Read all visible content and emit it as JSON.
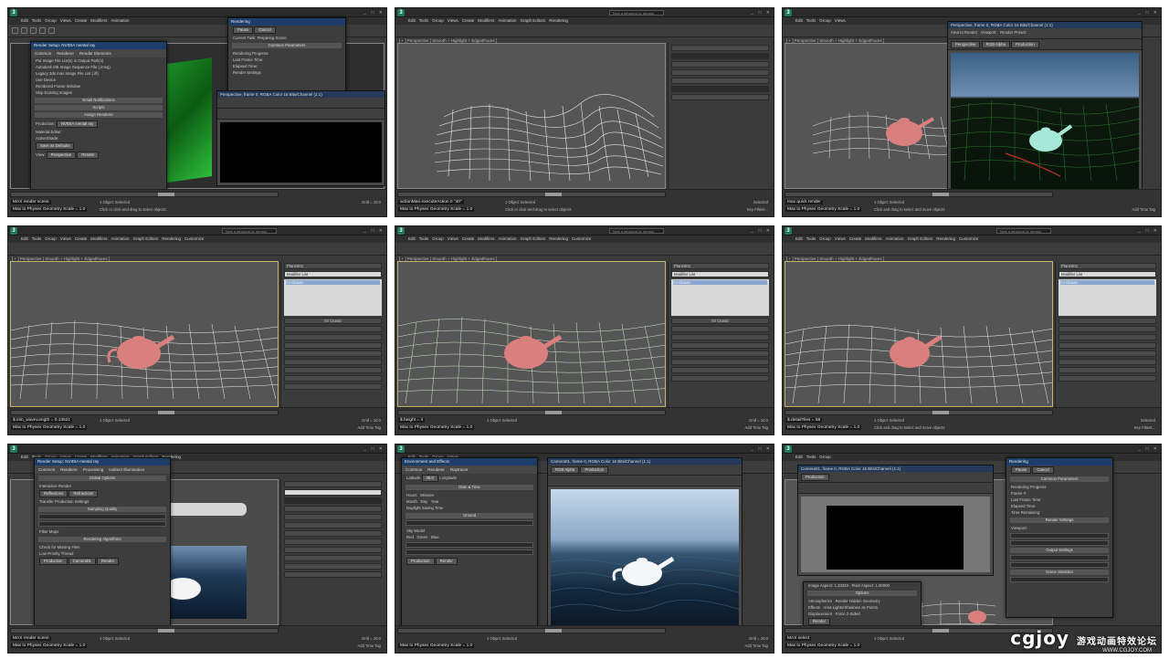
{
  "app": {
    "search_placeholder": "Type a keyword or phrase",
    "menu": [
      "Edit",
      "Tools",
      "Group",
      "Views",
      "Create",
      "Modifiers",
      "Animation",
      "Graph Editors",
      "Rendering",
      "Customize",
      "MAXScript",
      "Help",
      "PhysX",
      "Sample 1",
      "Fluid Flowmon"
    ],
    "viewport_label": "[ + ] Perspective ] Smooth + Highlight + EdgedFaces ]",
    "script_line": "Max to Physex Geometry Scale = 1.0",
    "status_selected": "1 Object Selected",
    "status_hint": "Click and drag to select and move objects",
    "status_hint_short": "Click or click-and-drag to select objects",
    "add_time_tag": "Add Time Tag",
    "selected": "Selected",
    "key_filters": "Key Filters...",
    "auto_key": "Auto Key",
    "set_key": "Set Key",
    "grid": "Grid = 10.0"
  },
  "panels": [
    {
      "id": 1,
      "listener": "MAX render scene",
      "dialogs": {
        "render_setup_title": "Render Setup: NVIDIA mental ray",
        "tabs": [
          "Common",
          "Renderer",
          "Indirect Illumination",
          "Processing",
          "Render Elements"
        ],
        "lines": [
          "Put Image File List(s) in Output Path(s)",
          "Autodesk ME Image Sequence File (.imsq)",
          "Legacy 3ds max Image File List (.ifl)",
          "Use Device",
          "Rendered Frame Window",
          "Net Render",
          "Skip Existing Images"
        ],
        "heads": [
          "Email Notifications",
          "Scripts",
          "Assign Renderer"
        ],
        "assign": [
          "Production:",
          "Material Editor:",
          "ActiveShade:"
        ],
        "renderer_value": "NVIDIA mental ray",
        "save_as_defaults": "Save as Defaults",
        "preset_label": "Preset:",
        "view_label": "View:",
        "view_value": "Perspective",
        "render_button": "Render",
        "rendering_title": "Rendering",
        "rendering_fields": [
          "Pause",
          "Cancel",
          "Current Task:",
          "Common Parameters",
          "Rendering Progress:",
          "Frame #",
          "Last Frame Time:",
          "Elapsed Time:",
          "Time Remaining:",
          "Render Settings"
        ],
        "current_task": "Preparing Scene"
      }
    },
    {
      "id": 2,
      "listener": "actionMan.executeAction 0 \"40\""
    },
    {
      "id": 3,
      "listener": "max quick render",
      "frame_title": "Perspective, frame 0, RGBA Color 16 Bits/Channel (1:1)",
      "area_to_render": "Area to Render",
      "viewport": "Viewport:",
      "render_preset": "Render Preset:",
      "view_value": "Perspective",
      "production": "Production",
      "rgb_alpha": "RGB Alpha"
    },
    {
      "id": 4,
      "listener": "$.min_waveLength = 0.13521",
      "modifier": "mr Ocean",
      "modifier_list": "Modifier List",
      "object_name": "Plane001"
    },
    {
      "id": 5,
      "listener": "$.height = 4",
      "modifier": "mr Ocean",
      "modifier_list": "Modifier List",
      "object_name": "Plane001"
    },
    {
      "id": 6,
      "listener": "$.detailTiles = 58",
      "modifier": "mr Ocean",
      "modifier_list": "Modifier List",
      "object_name": "Plane001"
    },
    {
      "id": 7,
      "listener": "MAX render scene",
      "render_setup_title": "Render Setup: NVIDIA mental ray",
      "tabs": [
        "Common",
        "Renderer",
        "Processing",
        "Indirect Illumination"
      ],
      "heads": [
        "Global Options",
        "Sampling Quality",
        "Rendering Algorithms"
      ],
      "lines": [
        "Interactive Render",
        "Reflections",
        "Refractions",
        "Transfer Production Settings",
        "Filter Maps",
        "Check for Missing Files",
        "Low-Priority Thread"
      ],
      "production": "Production",
      "render_button": "Render",
      "view_value": "Camera01"
    },
    {
      "id": 8,
      "env_title": "Environment and Effects",
      "tabs": [
        "Common",
        "Renderer",
        "Raytracer",
        "Indirect Illumination",
        "Processing",
        "Render Elements"
      ],
      "lines": [
        "Latitude",
        "Longitude",
        "Date & Time",
        "Hours",
        "Minutes",
        "Month",
        "Day",
        "Year",
        "Ground",
        "Sky Model",
        "Red",
        "Green",
        "Blue",
        "Daylight Saving Time"
      ],
      "frame_title": "Camera01, frame 0, RGBA Color 16 Bits/Channel (1:1)",
      "rgb_alpha": "RGB Alpha",
      "production": "Production",
      "render_button": "Render"
    },
    {
      "id": 9,
      "listener": "MAX select",
      "rendering_title": "Rendering",
      "rendering_fields": [
        "Pause",
        "Cancel",
        "Common Parameters",
        "Rendering Progress:",
        "Frame #:",
        "Last Frame Time:",
        "Elapsed Time:",
        "Time Remaining:",
        "Render Settings",
        "Viewport:",
        "Output Settings",
        "Scene Statistics"
      ],
      "frame_title": "Camera01, frame 0, RGBA Color 16 Bits/Channel (1:1)",
      "production": "Production",
      "render_button": "Render",
      "lines": [
        "Image Aspect: 1.33333",
        "Pixel Aspect: 1.00000",
        "Options",
        "Atmospherics",
        "Effects",
        "Displacement",
        "Render Hidden Geometry",
        "Area Lights/Shadows as Points",
        "Force 2-Sided",
        "Super Black"
      ]
    }
  ],
  "watermark": {
    "brand": "cgjoy",
    "chinese": "游戏动画特效论坛",
    "site": "WWW.CGJOY.COM"
  },
  "colors": {
    "bg": "#3a3a3a",
    "title_blue": "#1d3e6b",
    "wire_white": "#e8e8e8",
    "teapot_red": "#d9807e",
    "wire_green": "#3fa64a"
  }
}
